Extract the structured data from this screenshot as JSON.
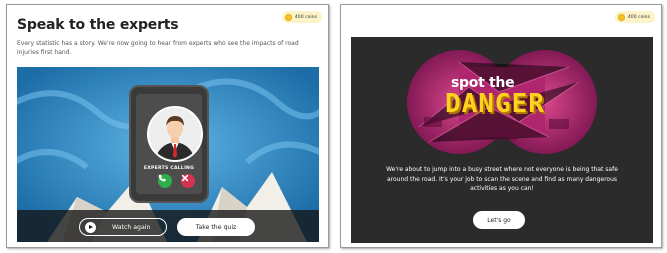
{
  "left_screen": {
    "coins": "400 coins",
    "title": "Speak to the experts",
    "intro": "Every statistic has a story. We're now going to hear from experts who see the impacts of road injuries first hand.",
    "caller_label": "EXPERTS CALLING",
    "accept_icon": "phone-accept-icon",
    "decline_icon": "close-icon",
    "watch_again": "Watch again",
    "take_quiz": "Take the quiz"
  },
  "right_screen": {
    "coins": "400 coins",
    "hero_line1": "spot the",
    "hero_line2": "DANGER",
    "description": "We're about to jump into a busy street where not everyone is being that safe around the road. It's your job to scan the scene and find as many dangerous activities as you can!",
    "lets_go": "Let's go"
  },
  "colors": {
    "video_blue": "#2a7fb7",
    "dark_panel": "#2b2b2b",
    "danger_yellow": "#ffd21f",
    "hero_magenta": "#b0266e",
    "accept_green": "#2eae4a",
    "decline_red": "#d43452"
  }
}
